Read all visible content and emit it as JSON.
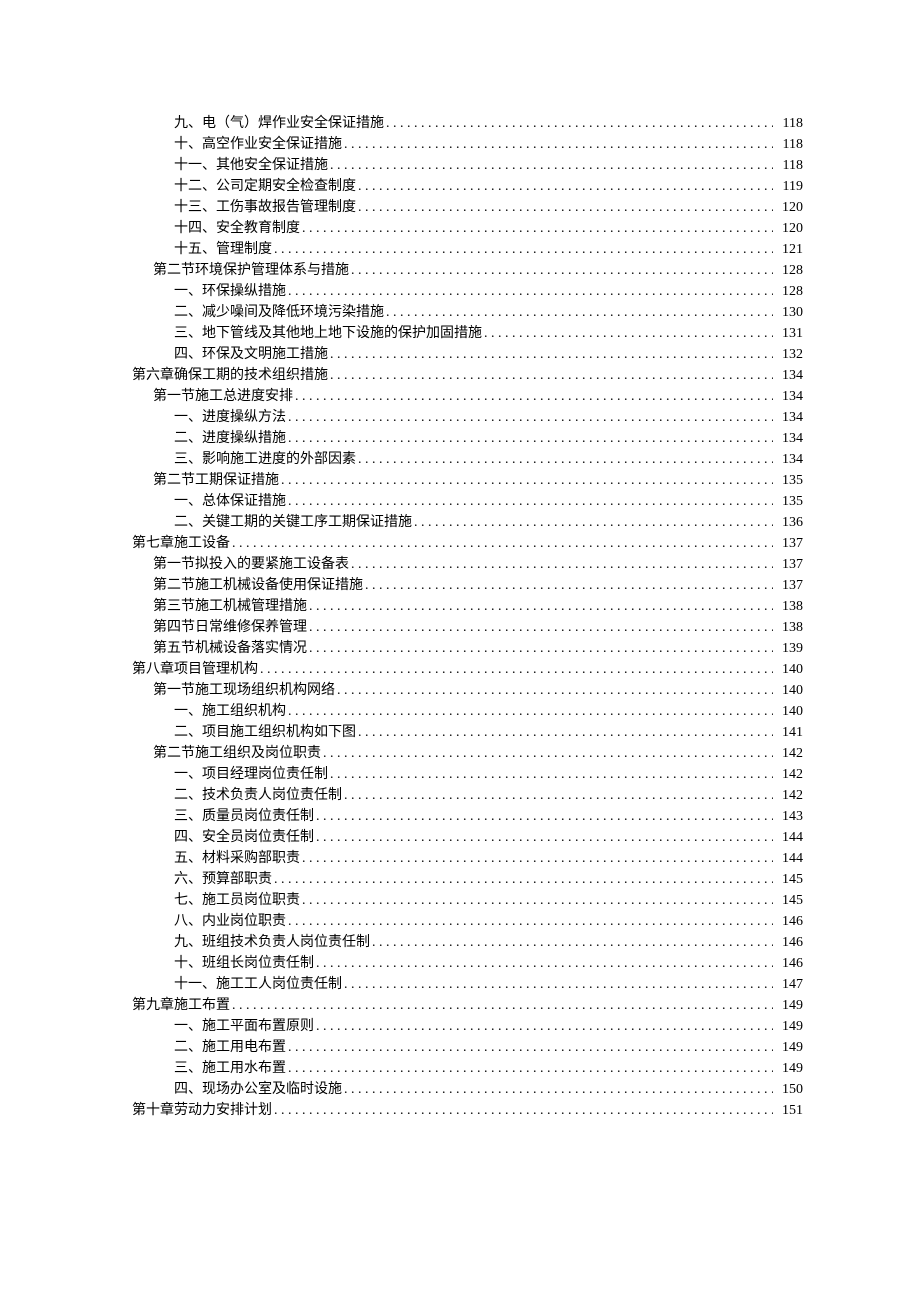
{
  "toc": [
    {
      "indent": 2,
      "dots": "tight",
      "label": "九、电（气）焊作业安全保证措施",
      "page": "118"
    },
    {
      "indent": 2,
      "dots": "tight",
      "label": "十、高空作业安全保证措施",
      "page": "118"
    },
    {
      "indent": 2,
      "dots": "tight",
      "label": "十一、其他安全保证措施",
      "page": "118"
    },
    {
      "indent": 2,
      "dots": "tight",
      "label": "十二、公司定期安全检查制度",
      "page": "119"
    },
    {
      "indent": 2,
      "dots": "tight",
      "label": "十三、工伤事故报告管理制度",
      "page": "120"
    },
    {
      "indent": 2,
      "dots": "tight",
      "label": "十四、安全教育制度",
      "page": "120"
    },
    {
      "indent": 2,
      "dots": "tight",
      "label": "十五、管理制度",
      "page": "121"
    },
    {
      "indent": 1,
      "dots": "spaced",
      "label": "第二节环境保护管理体系与措施 ",
      "page": "128"
    },
    {
      "indent": 2,
      "dots": "tight",
      "label": "一、环保操纵措施",
      "page": "128"
    },
    {
      "indent": 2,
      "dots": "tight",
      "label": "二、减少噪间及降低环境污染措施",
      "page": "130"
    },
    {
      "indent": 2,
      "dots": "tight",
      "label": "三、地下管线及其他地上地下设施的保护加固措施",
      "page": "131"
    },
    {
      "indent": 2,
      "dots": "tight",
      "label": "四、环保及文明施工措施",
      "page": "132"
    },
    {
      "indent": 0,
      "dots": "spaced",
      "label": "第六章确保工期的技术组织措施 ",
      "page": "134"
    },
    {
      "indent": 1,
      "dots": "spaced",
      "label": "第一节施工总进度安排 ",
      "page": "134"
    },
    {
      "indent": 2,
      "dots": "tight",
      "label": "一、进度操纵方法",
      "page": "134"
    },
    {
      "indent": 2,
      "dots": "tight",
      "label": "二、进度操纵措施",
      "page": "134"
    },
    {
      "indent": 2,
      "dots": "spaced",
      "label": "三、影响施工进度的外部因素 ",
      "page": "134"
    },
    {
      "indent": 1,
      "dots": "spaced",
      "label": "第二节工期保证措施 ",
      "page": "135"
    },
    {
      "indent": 2,
      "dots": "tight",
      "label": "一、总体保证措施",
      "page": "135"
    },
    {
      "indent": 2,
      "dots": "tight",
      "label": "二、关键工期的关键工序工期保证措施",
      "page": "136"
    },
    {
      "indent": 0,
      "dots": "spaced",
      "label": "第七章施工设备 ",
      "page": "137"
    },
    {
      "indent": 1,
      "dots": "spaced",
      "label": "第一节拟投入的要紧施工设备表 ",
      "page": "137"
    },
    {
      "indent": 1,
      "dots": "spaced",
      "label": "第二节施工机械设备使用保证措施 ",
      "page": "137"
    },
    {
      "indent": 1,
      "dots": "spaced",
      "label": "第三节施工机械管理措施 ",
      "page": "138"
    },
    {
      "indent": 1,
      "dots": "spaced",
      "label": "第四节日常维修保养管理 ",
      "page": "138"
    },
    {
      "indent": 1,
      "dots": "spaced",
      "label": "第五节机械设备落实情况 ",
      "page": "139"
    },
    {
      "indent": 0,
      "dots": "spaced",
      "label": "第八章项目管理机构 ",
      "page": "140"
    },
    {
      "indent": 1,
      "dots": "spaced",
      "label": "第一节施工现场组织机构网络 ",
      "page": "140"
    },
    {
      "indent": 2,
      "dots": "tight",
      "label": "一、施工组织机构",
      "page": "140"
    },
    {
      "indent": 2,
      "dots": "tight",
      "label": "二、项目施工组织机构如下图",
      "page": "141"
    },
    {
      "indent": 1,
      "dots": "spaced",
      "label": "第二节施工组织及岗位职责 ",
      "page": "142"
    },
    {
      "indent": 2,
      "dots": "tight",
      "label": "一、项目经理岗位责任制",
      "page": "142"
    },
    {
      "indent": 2,
      "dots": "tight",
      "label": "二、技术负责人岗位责任制",
      "page": "142"
    },
    {
      "indent": 2,
      "dots": "tight",
      "label": "三、质量员岗位责任制",
      "page": "143"
    },
    {
      "indent": 2,
      "dots": "tight",
      "label": "四、安全员岗位责任制",
      "page": "144"
    },
    {
      "indent": 2,
      "dots": "tight",
      "label": "五、材料采购部职责",
      "page": "144"
    },
    {
      "indent": 2,
      "dots": "tight",
      "label": "六、预算部职责",
      "page": "145"
    },
    {
      "indent": 2,
      "dots": "tight",
      "label": "七、施工员岗位职责",
      "page": "145"
    },
    {
      "indent": 2,
      "dots": "tight",
      "label": "八、内业岗位职责",
      "page": "146"
    },
    {
      "indent": 2,
      "dots": "tight",
      "label": "九、班组技术负责人岗位责任制",
      "page": "146"
    },
    {
      "indent": 2,
      "dots": "tight",
      "label": "十、班组长岗位责任制",
      "page": "146"
    },
    {
      "indent": 2,
      "dots": "tight",
      "label": "十一、施工工人岗位责任制",
      "page": "147"
    },
    {
      "indent": 0,
      "dots": "spaced",
      "label": "第九章施工布置 ",
      "page": "149"
    },
    {
      "indent": 2,
      "dots": "tight",
      "label": "一、施工平面布置原则",
      "page": "149"
    },
    {
      "indent": 2,
      "dots": "tight",
      "label": "二、施工用电布置",
      "page": "149"
    },
    {
      "indent": 2,
      "dots": "tight",
      "label": "三、施工用水布置",
      "page": "149"
    },
    {
      "indent": 2,
      "dots": "spaced",
      "label": "四、现场办公室及临时设施 ",
      "page": " 150"
    },
    {
      "indent": 0,
      "dots": "tight",
      "label": "第十章劳动力安排计划",
      "page": "151"
    }
  ]
}
